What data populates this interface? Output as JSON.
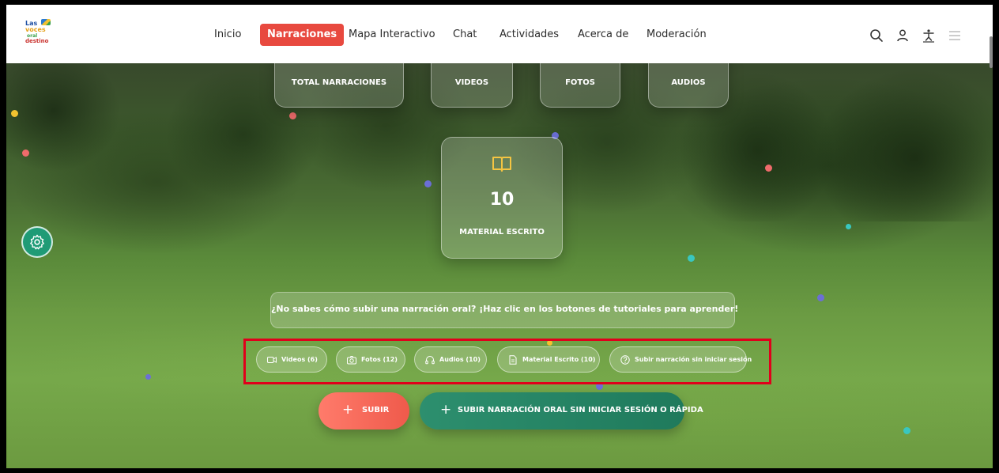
{
  "nav": {
    "logo": {
      "line1": "Las",
      "line2": "voces",
      "line3": "oral",
      "line4": "destino"
    },
    "menu": [
      "Inicio",
      "Narraciones",
      "Mapa Interactivo",
      "Chat",
      "Actividades",
      "Acerca de",
      "Moderación"
    ],
    "active": "Narraciones",
    "icons": [
      "search-icon",
      "user-icon",
      "accessibility-icon",
      "menu-icon"
    ]
  },
  "stats": {
    "total_label": "TOTAL NARRACIONES",
    "videos_label": "VIDEOS",
    "fotos_label": "FOTOS",
    "audios_label": "AUDIOS"
  },
  "featured": {
    "value": "10",
    "label": "MATERIAL ESCRITO",
    "icon": "book-icon"
  },
  "banner": "¿No sabes cómo subir una narración oral? ¡Haz clic en los botones de tutoriales para aprender!",
  "tutorials": {
    "videos": "Videos (6)",
    "fotos": "Fotos (12)",
    "audios": "Audios (10)",
    "escrito": "Material Escrito (10)",
    "sin_sesion": "Subir narración sin iniciar sesión"
  },
  "actions": {
    "subir": "SUBIR",
    "rapida": "SUBIR NARRACIÓN ORAL SIN INICIAR SESIÓN O RÁPIDA"
  },
  "colors": {
    "accent": "#e8493f",
    "green": "#1f7a5c",
    "highlight": "#e0001b"
  }
}
